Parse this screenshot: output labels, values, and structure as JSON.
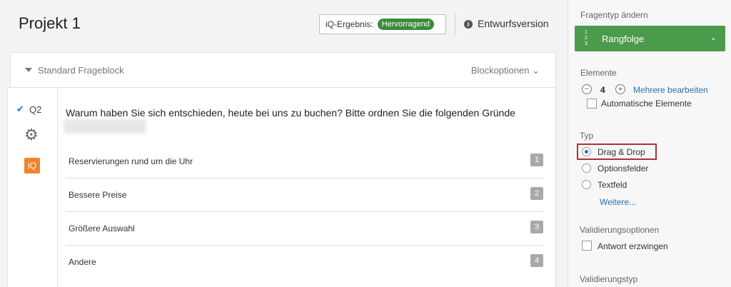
{
  "header": {
    "project_title": "Projekt 1",
    "iq_result_label": "iQ-Ergebnis:",
    "iq_result_badge": "Hervorragend",
    "draft_label": "Entwurfsversion"
  },
  "block": {
    "label": "Standard Frageblock",
    "options_label": "Blockoptionen ⌄"
  },
  "question": {
    "number": "Q2",
    "text": "Warum haben Sie sich entschieden, heute bei uns zu buchen? Bitte ordnen Sie die folgenden Gründe",
    "iq_tag": "iQ",
    "choices": [
      {
        "label": "Reservierungen rund um die Uhr",
        "rank": "1"
      },
      {
        "label": "Bessere Preise",
        "rank": "2"
      },
      {
        "label": "Größere Auswahl",
        "rank": "3"
      },
      {
        "label": "Andere",
        "rank": "4"
      }
    ]
  },
  "panel": {
    "change_type_label": "Fragentyp ändern",
    "question_type": "Rangfolge",
    "elements_label": "Elemente",
    "elements_count": "4",
    "edit_multiple_link": "Mehrere bearbeiten",
    "auto_elements_label": "Automatische Elemente",
    "type_label": "Typ",
    "type_options": [
      {
        "label": "Drag & Drop",
        "selected": true
      },
      {
        "label": "Optionsfelder",
        "selected": false
      },
      {
        "label": "Textfeld",
        "selected": false
      }
    ],
    "more_link": "Weitere...",
    "validation_options_label": "Validierungsoptionen",
    "force_answer_label": "Antwort erzwingen",
    "validation_type_label": "Validierungstyp"
  },
  "colors": {
    "accent_green": "#4c9a4c",
    "link_blue": "#2a6ebb",
    "iq_orange": "#f0842c",
    "highlight_red": "#aa3333"
  }
}
